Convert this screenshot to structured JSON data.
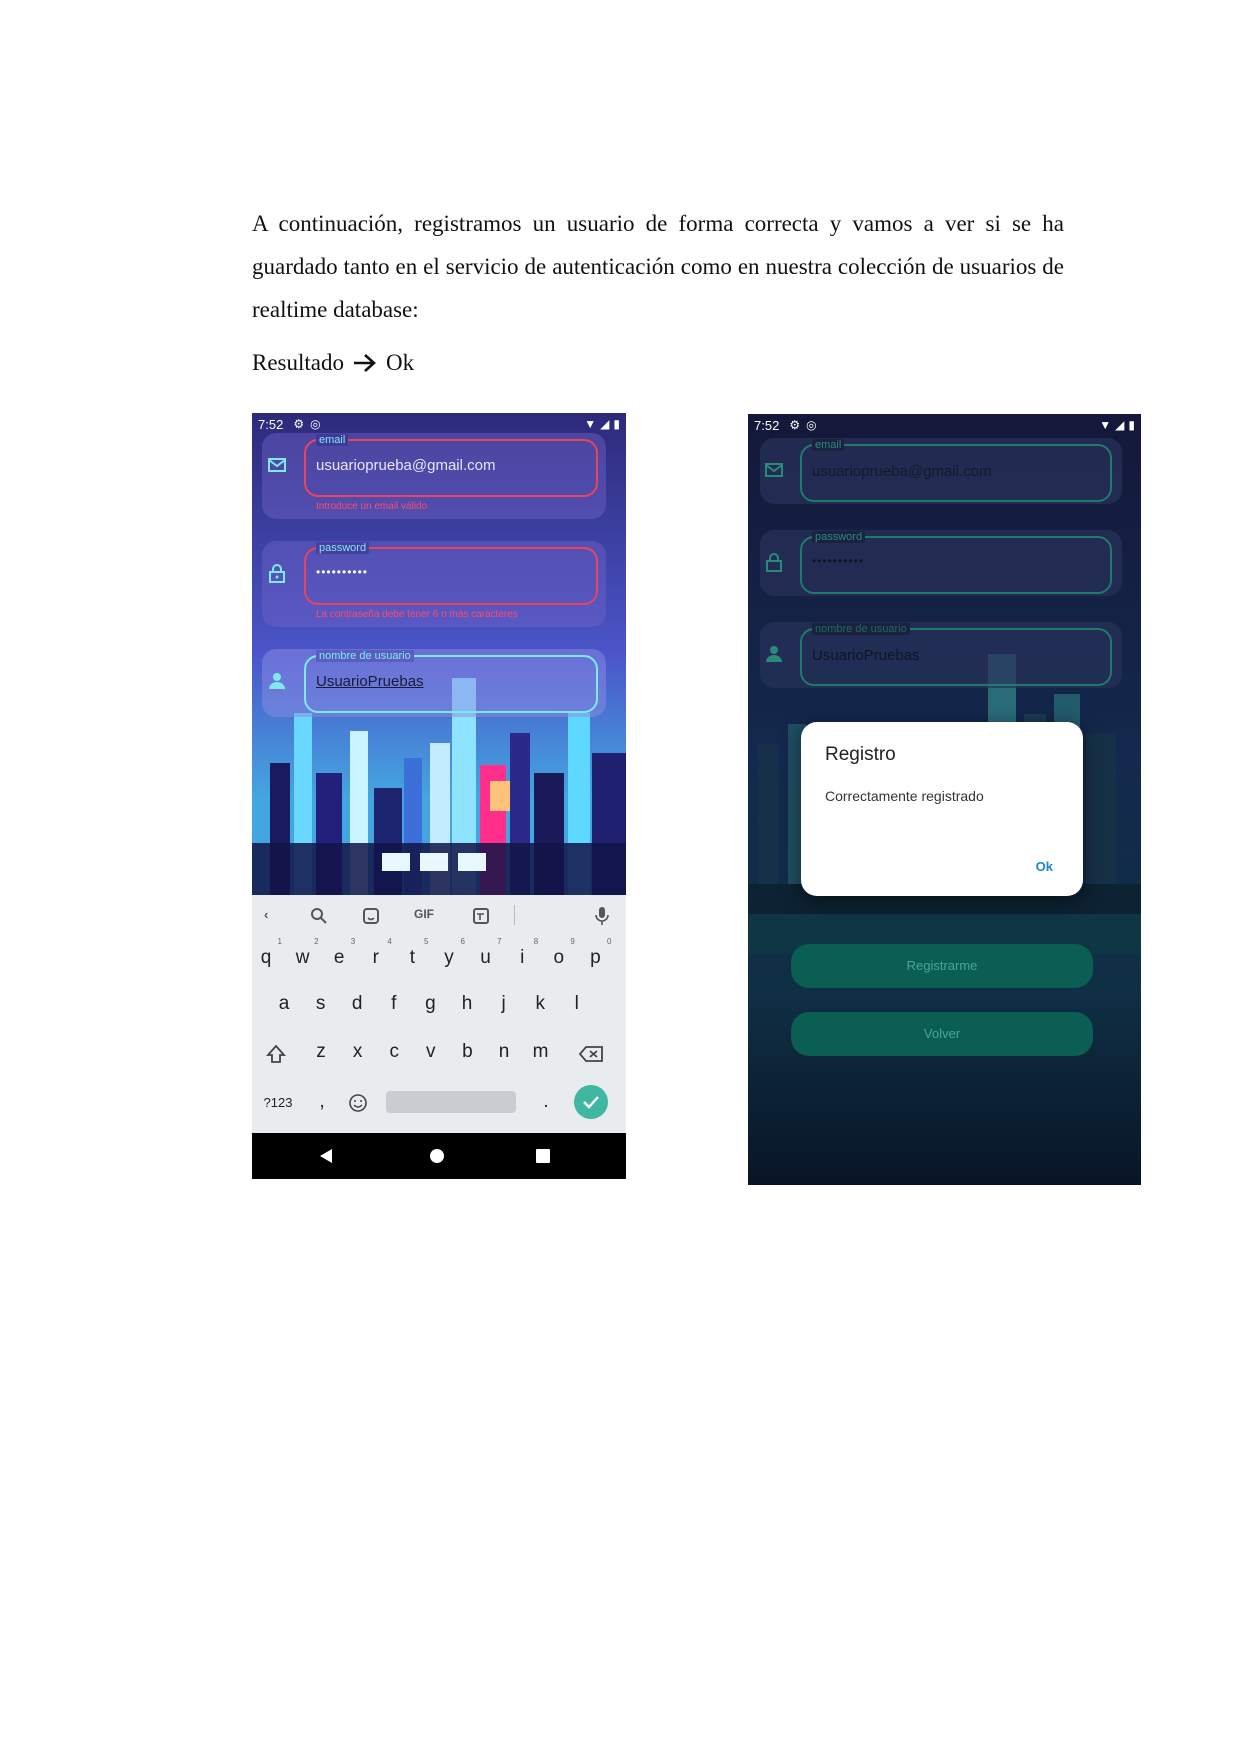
{
  "document": {
    "paragraph": "A continuación, registramos un usuario de forma correcta y vamos a ver si se ha guardado tanto en el servicio de autenticación como en nuestra colección de usuarios de realtime database:",
    "result_label": "Resultado",
    "result_value": "Ok"
  },
  "screen1": {
    "status_time": "7:52",
    "email_label": "email",
    "email_value": "usuarioprueba@gmail.com",
    "email_error": "Introduce un email válido",
    "password_label": "password",
    "password_value": "••••••••••",
    "password_error": "La contraseña debe tener 6 o más caracteres",
    "username_label": "nombre de usuario",
    "username_value": "UsuarioPruebas",
    "keyboard": {
      "gif": "GIF",
      "row1": [
        "q",
        "w",
        "e",
        "r",
        "t",
        "y",
        "u",
        "i",
        "o",
        "p"
      ],
      "row1_hints": [
        "1",
        "2",
        "3",
        "4",
        "5",
        "6",
        "7",
        "8",
        "9",
        "0"
      ],
      "row2": [
        "a",
        "s",
        "d",
        "f",
        "g",
        "h",
        "j",
        "k",
        "l"
      ],
      "row3": [
        "z",
        "x",
        "c",
        "v",
        "b",
        "n",
        "m"
      ],
      "symbols": "?123",
      "comma": ",",
      "period": "."
    }
  },
  "screen2": {
    "status_time": "7:52",
    "email_label": "email",
    "email_value": "usuarioprueba@gmail.com",
    "password_label": "password",
    "password_value": "••••••••••",
    "username_label": "nombre de usuario",
    "username_value": "UsuarioPruebas",
    "dialog_title": "Registro",
    "dialog_message": "Correctamente registrado",
    "dialog_ok": "Ok",
    "register_button": "Registrarme",
    "back_button": "Volver"
  },
  "colors": {
    "error_red": "#ff4a6a",
    "field_cyan": "#7fe8f0",
    "dialog_ok_blue": "#1a88c9",
    "button_teal": "#0b5e53",
    "keyboard_check": "#3fb7a3"
  }
}
